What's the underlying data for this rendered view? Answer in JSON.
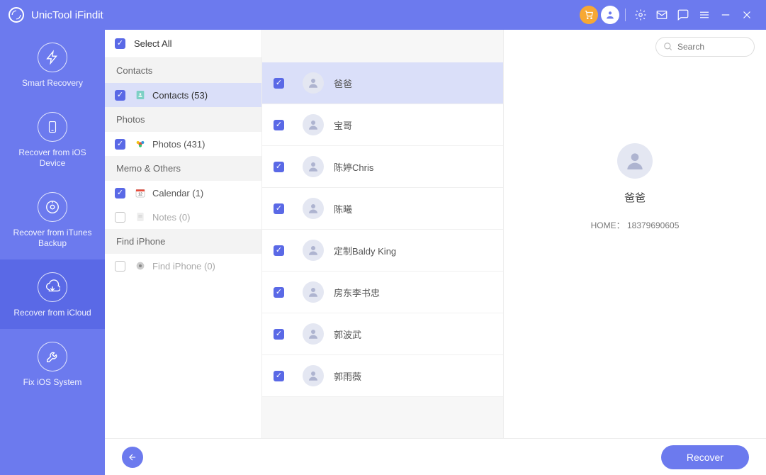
{
  "titlebar": {
    "title": "UnicTool iFindit"
  },
  "nav": {
    "items": [
      {
        "label": "Smart Recovery"
      },
      {
        "label": "Recover from iOS Device"
      },
      {
        "label": "Recover from iTunes Backup"
      },
      {
        "label": "Recover from iCloud"
      },
      {
        "label": "Fix iOS System"
      }
    ],
    "activeIndex": 3
  },
  "selectAll": {
    "label": "Select All",
    "checked": true
  },
  "categories": [
    {
      "type": "header",
      "label": "Contacts"
    },
    {
      "type": "item",
      "label": "Contacts (53)",
      "checked": true,
      "active": true,
      "icon": "contacts"
    },
    {
      "type": "header",
      "label": "Photos"
    },
    {
      "type": "item",
      "label": "Photos (431)",
      "checked": true,
      "icon": "photos"
    },
    {
      "type": "header",
      "label": "Memo & Others"
    },
    {
      "type": "item",
      "label": "Calendar (1)",
      "checked": true,
      "icon": "calendar"
    },
    {
      "type": "item",
      "label": "Notes (0)",
      "checked": false,
      "disabled": true,
      "icon": "notes"
    },
    {
      "type": "header",
      "label": "Find iPhone"
    },
    {
      "type": "item",
      "label": "Find iPhone (0)",
      "checked": false,
      "disabled": true,
      "icon": "findiphone"
    }
  ],
  "contacts": [
    {
      "name": "爸爸",
      "checked": true,
      "active": true
    },
    {
      "name": "宝哥",
      "checked": true
    },
    {
      "name": "陈婷Chris",
      "checked": true
    },
    {
      "name": "陈曦",
      "checked": true
    },
    {
      "name": "定制Baldy King",
      "checked": true
    },
    {
      "name": "房东李书忠",
      "checked": true
    },
    {
      "name": "郭波武",
      "checked": true
    },
    {
      "name": "郭雨薇",
      "checked": true
    }
  ],
  "search": {
    "placeholder": "Search"
  },
  "detail": {
    "name": "爸爸",
    "fieldLabel": "HOME：",
    "fieldValue": "18379690605"
  },
  "buttons": {
    "recover": "Recover"
  }
}
